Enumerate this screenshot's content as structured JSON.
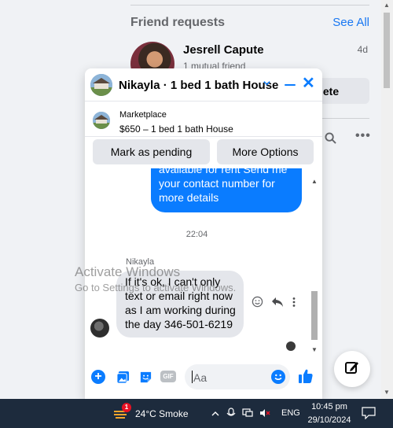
{
  "friend_requests": {
    "title": "Friend requests",
    "see_all": "See All",
    "item": {
      "name": "Jesrell Capute",
      "mutual": "1 mutual friend",
      "time": "4d",
      "delete_label": "lete"
    }
  },
  "chat": {
    "title": "Nikayla · 1 bed 1 bath House",
    "marketplace": {
      "label": "Marketplace",
      "detail": "$650 – 1 bed 1 bath House"
    },
    "actions": {
      "mark_pending": "Mark as pending",
      "more_options": "More Options"
    },
    "messages": {
      "outgoing_text": "available for rent Send me your contact number for more details",
      "timestamp": "22:04",
      "sender": "Nikayla",
      "incoming_text": "If it's ok, I can't only text or email right now as I am working during the day 346-501-6219"
    },
    "composer": {
      "placeholder": "Aa",
      "gif_label": "GIF"
    }
  },
  "watermark": {
    "line1": "Activate Windows",
    "line2": "Go to Settings to activate Windows."
  },
  "taskbar": {
    "weather": "24°C  Smoke",
    "badge": "1",
    "language": "ENG",
    "time": "10:45 pm",
    "date": "29/10/2024"
  },
  "colors": {
    "accent": "#0a7cff",
    "link": "#1877f2",
    "taskbar": "#1d2b3d"
  },
  "icons": [
    "search-icon",
    "more-icon",
    "chevron-down-icon",
    "minimize-icon",
    "close-icon",
    "emoji-icon",
    "reply-icon",
    "plus-icon",
    "photo-icon",
    "sticker-icon",
    "gif-icon",
    "like-icon",
    "compose-icon",
    "weather-icon",
    "notification-icon"
  ]
}
